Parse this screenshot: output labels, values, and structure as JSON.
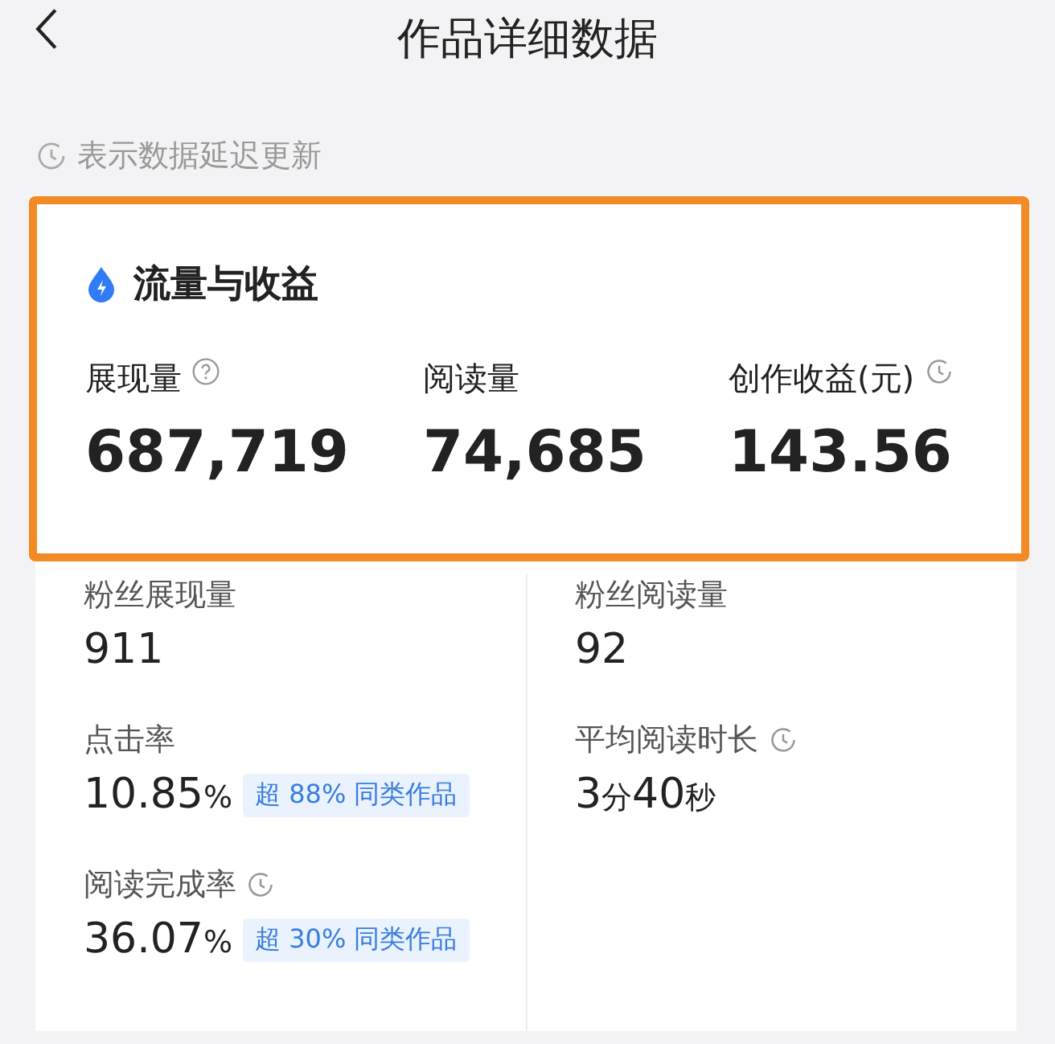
{
  "header": {
    "title": "作品详细数据"
  },
  "notice": {
    "text": "表示数据延迟更新"
  },
  "highlight_card": {
    "title": "流量与收益",
    "metrics": [
      {
        "label": "展现量",
        "help": true,
        "value": "687,719"
      },
      {
        "label": "阅读量",
        "value": "74,685"
      },
      {
        "label": "创作收益(元)",
        "delayed": true,
        "value": "143.56"
      }
    ]
  },
  "stats": {
    "columns": [
      {
        "items": [
          {
            "label": "粉丝展现量",
            "parts": [
              {
                "kind": "number",
                "text": "911"
              }
            ]
          },
          {
            "label": "点击率",
            "parts": [
              {
                "kind": "number",
                "text": "10.85"
              },
              {
                "kind": "unit",
                "text": "%"
              }
            ],
            "badge": "超 88% 同类作品"
          },
          {
            "label": "阅读完成率",
            "delayed": true,
            "parts": [
              {
                "kind": "number",
                "text": "36.07"
              },
              {
                "kind": "unit",
                "text": "%"
              }
            ],
            "badge": "超 30% 同类作品"
          }
        ]
      },
      {
        "items": [
          {
            "label": "粉丝阅读量",
            "parts": [
              {
                "kind": "number",
                "text": "92"
              }
            ]
          },
          {
            "label": "平均阅读时长",
            "delayed": true,
            "parts": [
              {
                "kind": "number",
                "text": "3"
              },
              {
                "kind": "unit",
                "text": "分"
              },
              {
                "kind": "number",
                "text": "40"
              },
              {
                "kind": "unit",
                "text": "秒"
              }
            ]
          }
        ]
      }
    ]
  }
}
